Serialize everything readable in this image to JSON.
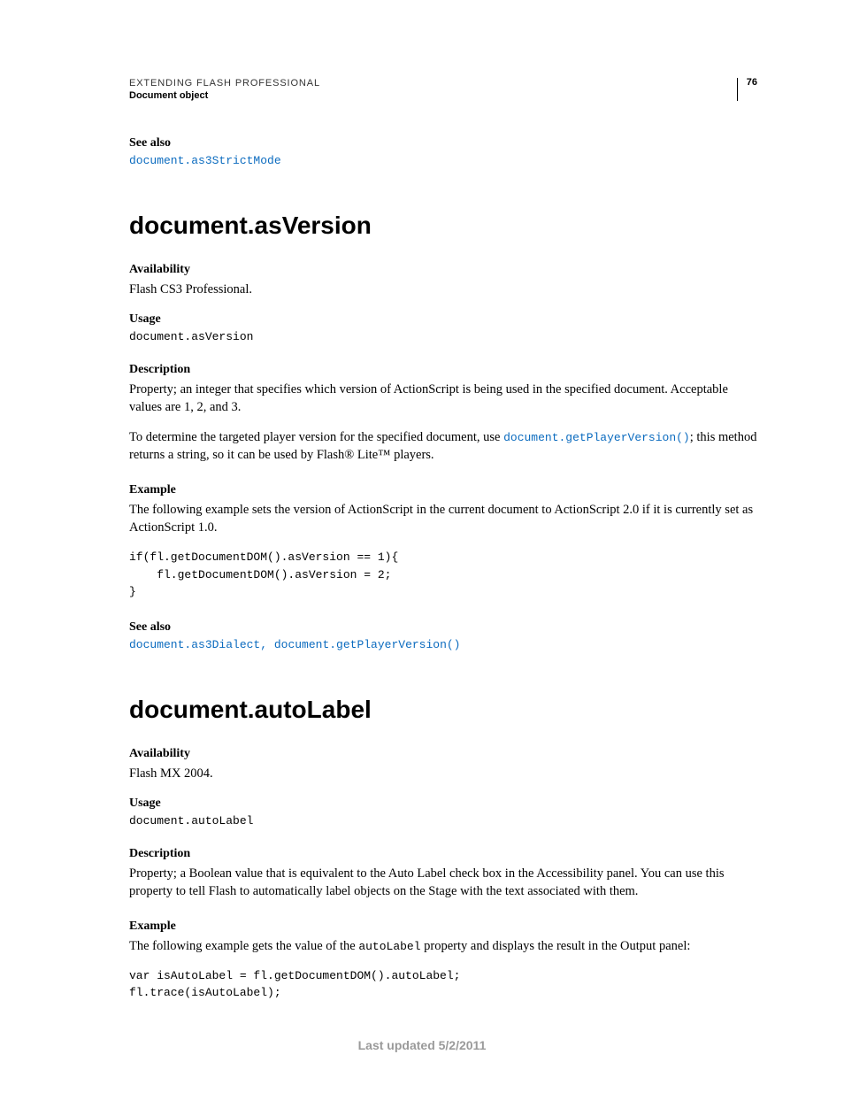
{
  "header": {
    "line1": "EXTENDING FLASH PROFESSIONAL",
    "line2": "Document object",
    "page_number": "76"
  },
  "intro_seealso": {
    "label": "See also",
    "links": [
      "document.as3StrictMode"
    ]
  },
  "topics": [
    {
      "heading": "document.asVersion",
      "availability": {
        "label": "Availability",
        "text": "Flash CS3 Professional."
      },
      "usage": {
        "label": "Usage",
        "code": "document.asVersion"
      },
      "description": {
        "label": "Description",
        "para1": "Property; an integer that specifies which version of ActionScript is being used in the specified document. Acceptable values are 1, 2, and 3.",
        "para2_pre": "To determine the targeted player version for the specified document, use ",
        "para2_code": "document.getPlayerVersion()",
        "para2_post": "; this method returns a string, so it can be used by Flash® Lite™ players."
      },
      "example": {
        "label": "Example",
        "intro": "The following example sets the version of ActionScript in the current document to ActionScript 2.0 if it is currently set as ActionScript 1.0.",
        "code": "if(fl.getDocumentDOM().asVersion == 1){\n    fl.getDocumentDOM().asVersion = 2;\n}"
      },
      "seealso": {
        "label": "See also",
        "links": [
          "document.as3Dialect",
          "document.getPlayerVersion()"
        ]
      }
    },
    {
      "heading": "document.autoLabel",
      "availability": {
        "label": "Availability",
        "text": "Flash MX 2004."
      },
      "usage": {
        "label": "Usage",
        "code": "document.autoLabel"
      },
      "description": {
        "label": "Description",
        "para1": "Property; a Boolean value that is equivalent to the Auto Label check box in the Accessibility panel. You can use this property to tell Flash to automatically label objects on the Stage with the text associated with them."
      },
      "example": {
        "label": "Example",
        "intro_pre": "The following example gets the value of the ",
        "intro_code": "autoLabel",
        "intro_post": " property and displays the result in the Output panel:",
        "code": "var isAutoLabel = fl.getDocumentDOM().autoLabel;\nfl.trace(isAutoLabel);"
      }
    }
  ],
  "footer": "Last updated 5/2/2011"
}
